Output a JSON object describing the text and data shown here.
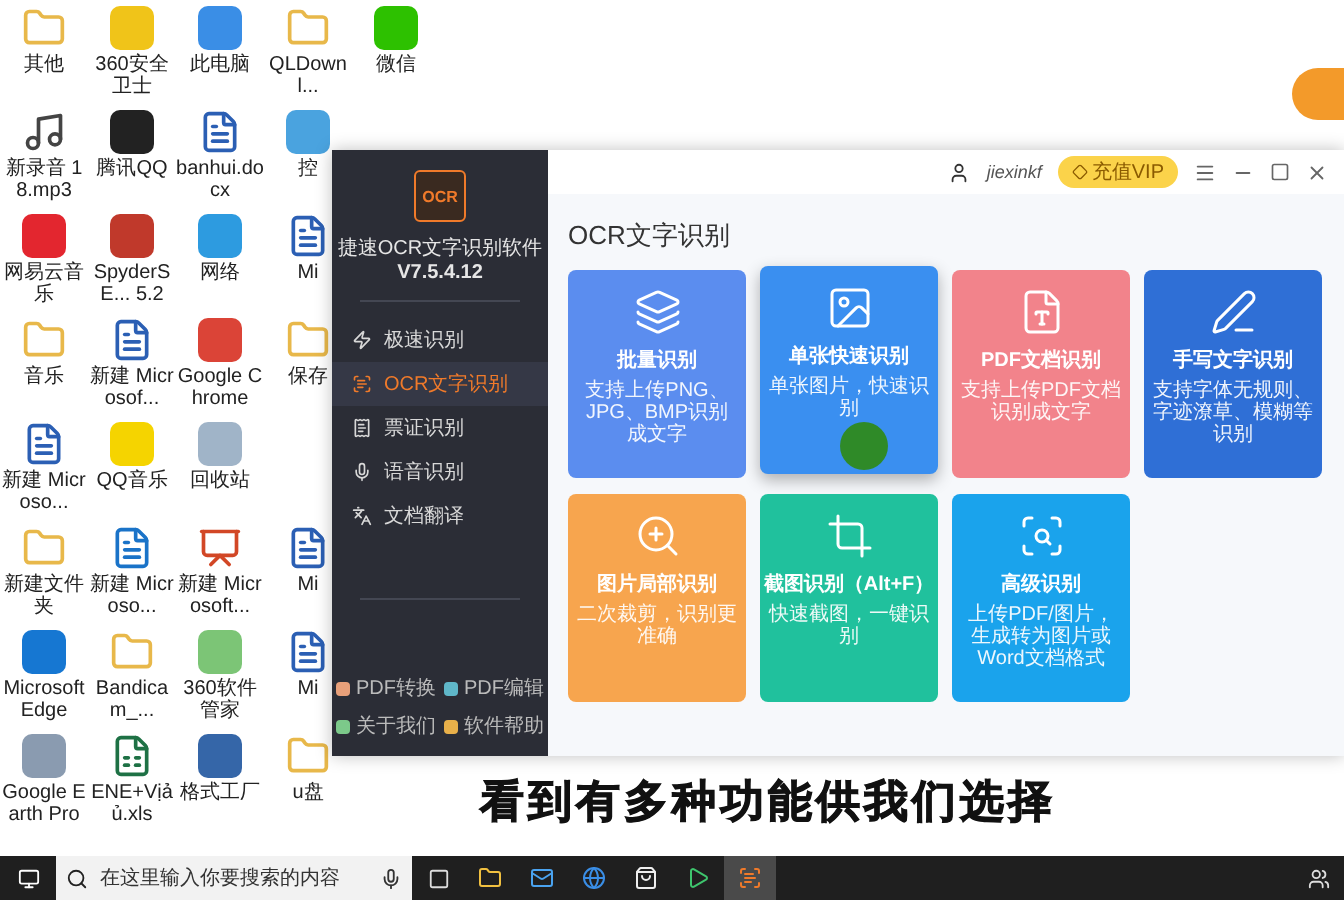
{
  "desktop": {
    "columns": [
      [
        {
          "label": "其他",
          "kind": "folder"
        },
        {
          "label": "新录音 18.mp3",
          "kind": "media"
        },
        {
          "label": "网易云音乐",
          "kind": "app",
          "color": "#e3262f"
        },
        {
          "label": "音乐",
          "kind": "folder"
        },
        {
          "label": "新建 Microso...",
          "kind": "word"
        },
        {
          "label": "新建文件夹",
          "kind": "folder"
        },
        {
          "label": "Microsoft Edge",
          "kind": "app",
          "color": "#1677d2"
        },
        {
          "label": "Google Earth Pro",
          "kind": "app",
          "color": "#8a9bb0"
        }
      ],
      [
        {
          "label": "360安全卫士",
          "kind": "app",
          "color": "#f0c419"
        },
        {
          "label": "腾讯QQ",
          "kind": "app",
          "color": "#222222"
        },
        {
          "label": "SpyderSE... 5.2",
          "kind": "app",
          "color": "#c0392b"
        },
        {
          "label": "新建 Microsof...",
          "kind": "word"
        },
        {
          "label": "QQ音乐",
          "kind": "app",
          "color": "#f5d400"
        },
        {
          "label": "新建 Microso...",
          "kind": "pdf"
        },
        {
          "label": "Bandicam_...",
          "kind": "folder"
        },
        {
          "label": "ENE+Vịả ủ.xls",
          "kind": "excel"
        }
      ],
      [
        {
          "label": "此电脑",
          "kind": "app",
          "color": "#3a8ee6"
        },
        {
          "label": "banhui.docx",
          "kind": "word"
        },
        {
          "label": "网络",
          "kind": "app",
          "color": "#2d9be0"
        },
        {
          "label": "Google Chrome",
          "kind": "app",
          "color": "#db4437"
        },
        {
          "label": "回收站",
          "kind": "app",
          "color": "#a0b4c8"
        },
        {
          "label": "新建 Microsoft...",
          "kind": "ppt"
        },
        {
          "label": "360软件管家",
          "kind": "app",
          "color": "#7cc576"
        },
        {
          "label": "格式工厂",
          "kind": "app",
          "color": "#3566a8"
        }
      ],
      [
        {
          "label": "QLDownl...",
          "kind": "folder"
        },
        {
          "label": "控",
          "kind": "app",
          "color": "#4aa3df"
        },
        {
          "label": "Mi",
          "kind": "word"
        },
        {
          "label": "保存",
          "kind": "folder"
        },
        {
          "kind": "gap"
        },
        {
          "label": "Mi",
          "kind": "word"
        },
        {
          "label": "Mi",
          "kind": "word"
        },
        {
          "label": "u盘",
          "kind": "folder"
        }
      ],
      [
        {
          "label": "微信",
          "kind": "app",
          "color": "#2dc100"
        }
      ]
    ]
  },
  "app": {
    "logo": "OCR",
    "name": "捷速OCR文字识别软件",
    "version": "V7.5.4.12",
    "menu": [
      {
        "label": "极速识别",
        "selected": false
      },
      {
        "label": "OCR文字识别",
        "selected": true
      },
      {
        "label": "票证识别",
        "selected": false
      },
      {
        "label": "语音识别",
        "selected": false
      },
      {
        "label": "文档翻译",
        "selected": false
      }
    ],
    "links": [
      {
        "label": "PDF转换",
        "color": "#e8a07a"
      },
      {
        "label": "PDF编辑",
        "color": "#5fb7c9"
      },
      {
        "label": "关于我们",
        "color": "#7cc98a"
      },
      {
        "label": "软件帮助",
        "color": "#e8b04a"
      }
    ],
    "user": "jiexinkf",
    "vip": "充值VIP",
    "heading": "OCR文字识别",
    "cards": [
      {
        "title": "批量识别",
        "desc": "支持上传PNG、JPG、BMP识别成文字",
        "color": "#5b8def",
        "hovered": false
      },
      {
        "title": "单张快速识别",
        "desc": "单张图片，快速识别",
        "color": "#3a8ff0",
        "hovered": true
      },
      {
        "title": "PDF文档识别",
        "desc": "支持上传PDF文档识别成文字",
        "color": "#f2838b",
        "hovered": false
      },
      {
        "title": "手写文字识别",
        "desc": "支持字体无规则、字迹潦草、模糊等识别",
        "color": "#2f6fd6",
        "hovered": false
      },
      {
        "title": "图片局部识别",
        "desc": "二次裁剪，识别更准确",
        "color": "#f7a54e",
        "hovered": false
      },
      {
        "title": "截图识别（Alt+F）",
        "desc": "快速截图，一键识别",
        "color": "#20c19d",
        "hovered": false
      },
      {
        "title": "高级识别",
        "desc": "上传PDF/图片，生成转为图片或Word文档格式",
        "color": "#1aa3ec",
        "hovered": false
      }
    ]
  },
  "subtitle": "看到有多种功能供我们选择",
  "taskbar": {
    "search": {
      "placeholder": "在这里输入你要搜索的内容"
    }
  }
}
